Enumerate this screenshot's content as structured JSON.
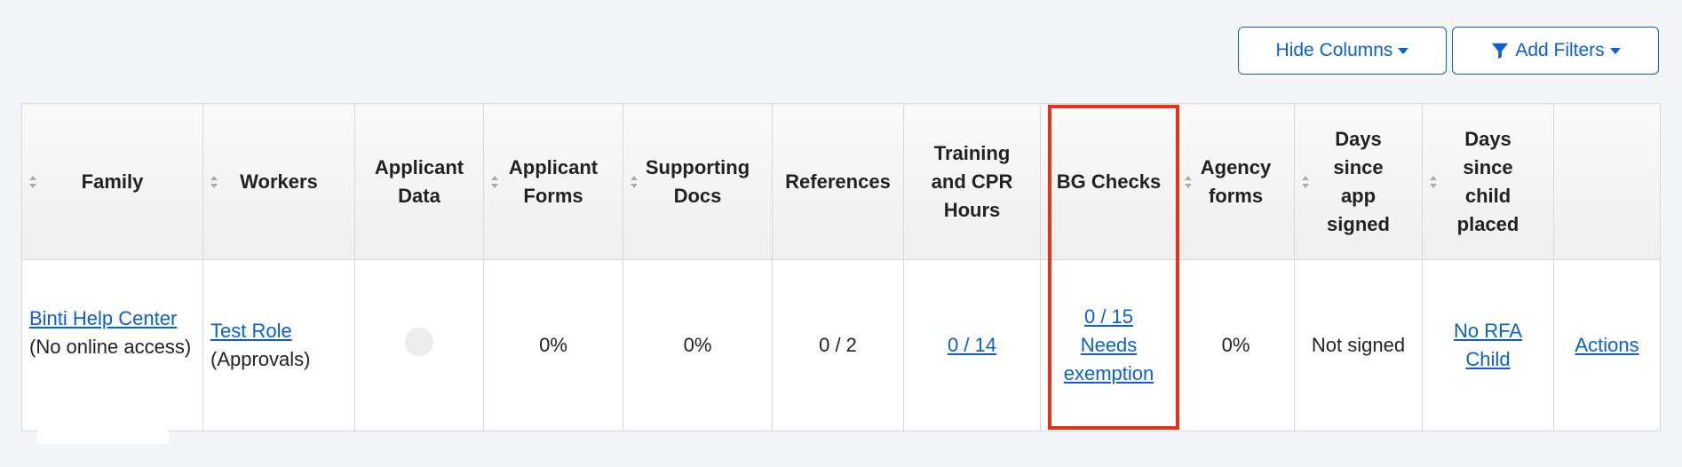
{
  "toolbar": {
    "hide_columns_label": "Hide Columns",
    "add_filters_label": "Add Filters"
  },
  "columns": [
    {
      "key": "family",
      "label": "Family",
      "sortable": true
    },
    {
      "key": "workers",
      "label": "Workers",
      "sortable": true
    },
    {
      "key": "applicant_data",
      "label": "Applicant Data",
      "sortable": false
    },
    {
      "key": "applicant_forms",
      "label": "Applicant Forms",
      "sortable": true
    },
    {
      "key": "supporting_docs",
      "label": "Supporting Docs",
      "sortable": true
    },
    {
      "key": "references",
      "label": "References",
      "sortable": false
    },
    {
      "key": "training",
      "label": "Training and CPR Hours",
      "sortable": false
    },
    {
      "key": "bg_checks",
      "label": "BG Checks",
      "sortable": false
    },
    {
      "key": "agency_forms",
      "label": "Agency forms",
      "sortable": true
    },
    {
      "key": "days_app_signed",
      "label": "Days since app signed",
      "sortable": true
    },
    {
      "key": "days_child_placed",
      "label": "Days since child placed",
      "sortable": true
    },
    {
      "key": "actions",
      "label": "",
      "sortable": false
    }
  ],
  "row": {
    "family_link": "Binti Help Center ",
    "family_note": "(No online access)",
    "worker_link": "Test Role",
    "worker_note": "(Approvals)",
    "applicant_forms": "0%",
    "supporting_docs": "0%",
    "references": "0 / 2",
    "training": "0 / 14",
    "bg_checks_count": "0 / 15",
    "bg_checks_status": "Needs exemption",
    "agency_forms": "0%",
    "days_app_signed": "Not signed",
    "days_child_placed": "No RFA Child",
    "actions": "Actions"
  },
  "colors": {
    "link": "#0a60d6",
    "highlight": "#e8311a"
  }
}
